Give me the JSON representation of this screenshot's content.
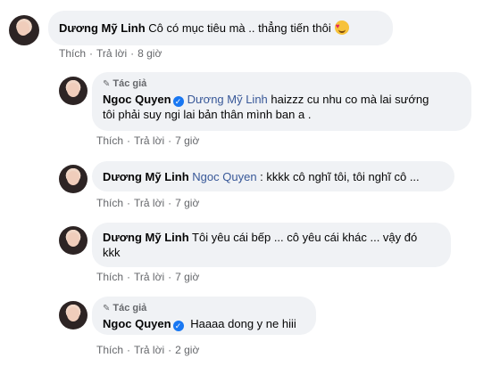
{
  "comments": [
    {
      "author": "Dương Mỹ Linh",
      "text": "Cô có mục tiêu mà .. thẳng tiến thôi",
      "emoji": "smiling-face-with-hearts",
      "like": "Thích",
      "reply": "Trả lời",
      "time": "8 giờ"
    },
    {
      "tag": "Tác giả",
      "author": "Ngoc Quyen",
      "mention": "Dương Mỹ Linh",
      "text_line1": "haizzz cu nhu co mà lai sướng",
      "text_line2": "tôi phải suy ngi lai bản thân mình ban a .",
      "like": "Thích",
      "reply": "Trả lời",
      "time": "7 giờ"
    },
    {
      "author": "Dương Mỹ Linh",
      "mention": "Ngoc Quyen",
      "text": ": kkkk cô nghĩ tôi, tôi nghĩ cô ...",
      "like": "Thích",
      "reply": "Trả lời",
      "time": "7 giờ"
    },
    {
      "author": "Dương Mỹ Linh",
      "text_line1": "Tôi yêu cái bếp ... cô yêu cái khác ... vậy đó",
      "text_line2": "kkk",
      "like": "Thích",
      "reply": "Trả lời",
      "time": "7 giờ"
    },
    {
      "tag": "Tác giả",
      "author": "Ngoc Quyen",
      "text": "Haaaa dong y ne hiii",
      "like": "Thích",
      "reply": "Trả lời",
      "time": "2 giờ"
    }
  ],
  "separator": "·"
}
